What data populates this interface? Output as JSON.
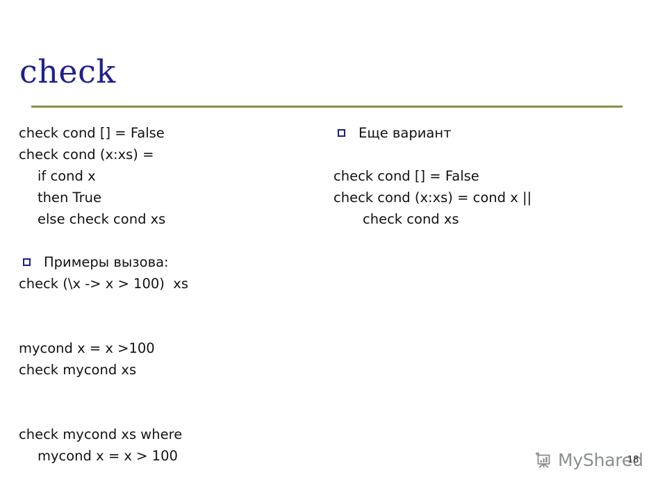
{
  "slide": {
    "title": "check",
    "page_number": "18",
    "accent_color": "#1f1f8f",
    "rule_color": "#8d8b4a",
    "bullet_color": "#1b1b8c",
    "text_color": "#111111"
  },
  "left_column": {
    "code_block_1": [
      "check cond [] = False",
      "check cond (x:xs) =",
      "if cond x",
      "then True",
      "else check cond xs"
    ],
    "bullet_1": "Примеры вызова:",
    "code_block_2": [
      "check (\\x -> x > 100)  xs"
    ],
    "code_block_3": [
      "mycond x = x >100",
      "check mycond xs"
    ],
    "code_block_4": [
      "check mycond xs where",
      "mycond x = x > 100"
    ]
  },
  "right_column": {
    "bullet_1": "Еще вариант",
    "code_block_1": [
      "check cond [] = False",
      "check cond (x:xs) = cond x ||",
      "check cond xs"
    ]
  },
  "watermark": {
    "icon": "flipchart-presentation-icon",
    "text": "MyShared",
    "color": "#5c6660"
  }
}
